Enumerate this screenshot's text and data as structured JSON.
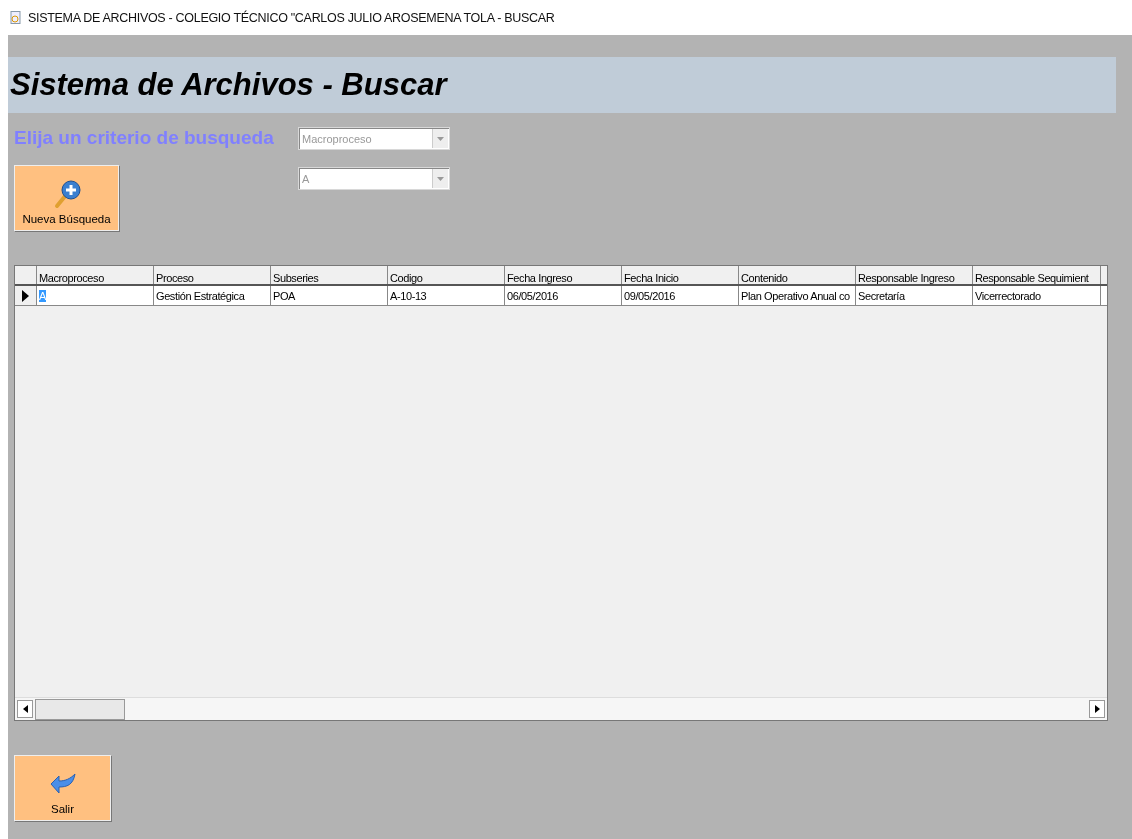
{
  "window": {
    "title": "SISTEMA DE ARCHIVOS - COLEGIO TÉCNICO \"CARLOS JULIO AROSEMENA TOLA - BUSCAR"
  },
  "header": {
    "title": "Sistema de Archivos - Buscar"
  },
  "criteria": {
    "label": "Elija un criterio de busqueda",
    "combos": [
      {
        "value": "Macroproceso"
      },
      {
        "value": "A"
      }
    ]
  },
  "buttons": [
    {
      "kind": "search",
      "label": "Nueva Búsqueda"
    },
    {
      "kind": "back",
      "label": "Salir"
    }
  ],
  "table": {
    "columns": [
      "Macroproceso",
      "Proceso",
      "Subseries",
      "Codigo",
      "Fecha Ingreso",
      "Fecha Inicio",
      "Contenido",
      "Responsable Ingreso",
      "Responsable Sequimient"
    ],
    "rows": [
      {
        "selected": true,
        "cells": [
          "A",
          "Gestión Estratégica",
          "POA",
          "A-10-13",
          "06/05/2016",
          "09/05/2016",
          "Plan Operativo Anual co",
          "Secretaría",
          "Vicerrectorado"
        ]
      }
    ]
  }
}
